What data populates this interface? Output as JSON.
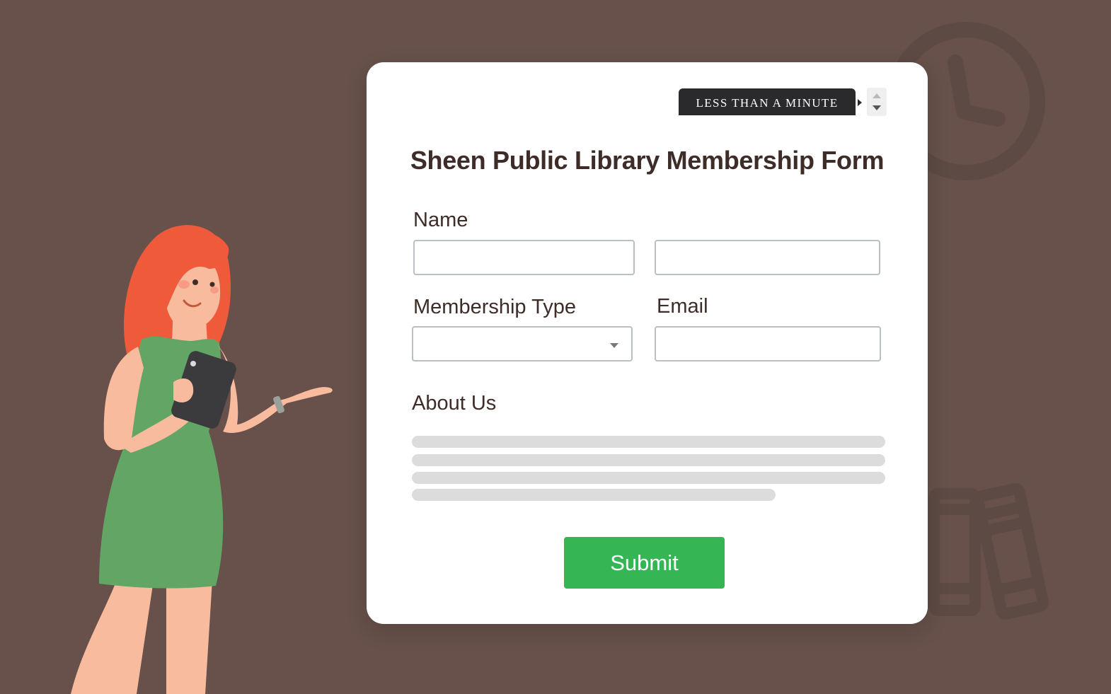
{
  "form": {
    "duration_badge": "LESS THAN A MINUTE",
    "title": "Sheen Public Library Membership Form",
    "name_label": "Name",
    "first_name_value": "",
    "last_name_value": "",
    "membership_type_label": "Membership Type",
    "membership_type_value": "",
    "email_label": "Email",
    "email_value": "",
    "about_label": "About Us",
    "submit_label": "Submit"
  },
  "colors": {
    "background": "#67514a",
    "card": "#ffffff",
    "title_text": "#3d2c28",
    "submit_button": "#35b554",
    "badge": "#2a2a2d",
    "placeholder_lines": "#dcdcdc"
  },
  "icons": [
    "clock-icon",
    "books-icon",
    "woman-with-tablet-illustration",
    "chevron-down-icon",
    "spinner-up-icon",
    "spinner-down-icon"
  ]
}
